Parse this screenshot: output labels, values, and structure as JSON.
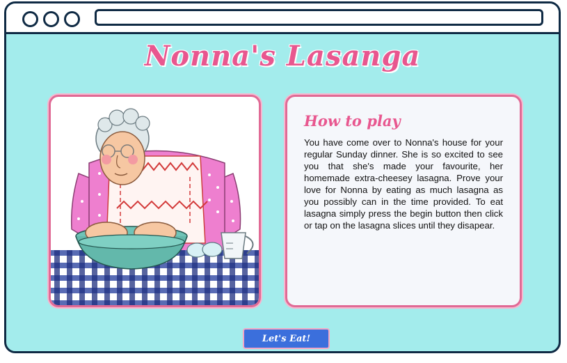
{
  "page": {
    "title": "Nonna's Lasanga"
  },
  "instructions": {
    "heading": "How to play",
    "body": "You have come over to Nonna's house for your regular Sunday dinner. She is so excited to see you that she's made your favourite, her homemade extra-cheesey lasagna. Prove your love for Nonna by eating as much lasagna as you possibly can in the time provided. To eat lasagna simply press the begin button then click or tap on the lasagna slices until they disapear."
  },
  "actions": {
    "start_label": "Let's Eat!"
  },
  "colors": {
    "background": "#a3ecec",
    "accent_pink": "#e8578f",
    "button_blue": "#3b6fdc",
    "frame_navy": "#0f2a44"
  },
  "illustration": {
    "subject": "grandmother-kneading-dough"
  }
}
